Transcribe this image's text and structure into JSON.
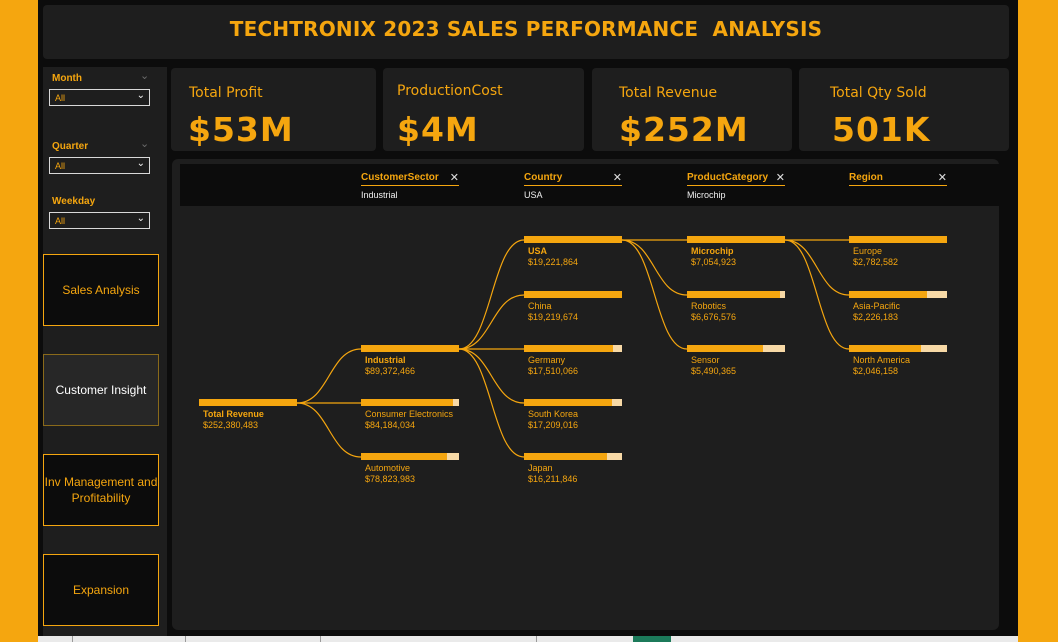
{
  "title": "TECHTRONIX 2023 SALES PERFORMANCE  ANALYSIS",
  "slicers": [
    {
      "label": "Month",
      "value": "All"
    },
    {
      "label": "Quarter",
      "value": "All"
    },
    {
      "label": "Weekday",
      "value": "All"
    }
  ],
  "nav": [
    {
      "label": "Sales Analysis"
    },
    {
      "label": "Customer Insight"
    },
    {
      "label": "Inv Management and Profitability"
    },
    {
      "label": "Expansion"
    }
  ],
  "kpis": [
    {
      "label": "Total Profit",
      "value": "$53M"
    },
    {
      "label": "ProductionCost",
      "value": "$4M"
    },
    {
      "label": "Total Revenue",
      "value": "$252M"
    },
    {
      "label": "Total Qty Sold",
      "value": "501K"
    }
  ],
  "tree": {
    "levels": [
      {
        "header": "CustomerSector",
        "selection": "Industrial"
      },
      {
        "header": "Country",
        "selection": "USA"
      },
      {
        "header": "ProductCategory",
        "selection": "Microchip"
      },
      {
        "header": "Region",
        "selection": ""
      }
    ],
    "root": {
      "label": "Total Revenue",
      "value": "$252,380,483",
      "fraction": 1.0
    },
    "columns": [
      [
        {
          "label": "Industrial",
          "value": "$89,372,466",
          "fraction": 1.0,
          "selected": true
        },
        {
          "label": "Consumer Electronics",
          "value": "$84,184,034",
          "fraction": 0.942
        },
        {
          "label": "Automotive",
          "value": "$78,823,983",
          "fraction": 0.882
        }
      ],
      [
        {
          "label": "USA",
          "value": "$19,221,864",
          "fraction": 1.0,
          "selected": true
        },
        {
          "label": "China",
          "value": "$19,219,674",
          "fraction": 1.0
        },
        {
          "label": "Germany",
          "value": "$17,510,066",
          "fraction": 0.911
        },
        {
          "label": "South Korea",
          "value": "$17,209,016",
          "fraction": 0.895
        },
        {
          "label": "Japan",
          "value": "$16,211,846",
          "fraction": 0.843
        }
      ],
      [
        {
          "label": "Microchip",
          "value": "$7,054,923",
          "fraction": 1.0,
          "selected": true
        },
        {
          "label": "Robotics",
          "value": "$6,676,576",
          "fraction": 0.946
        },
        {
          "label": "Sensor",
          "value": "$5,490,365",
          "fraction": 0.778
        }
      ],
      [
        {
          "label": "Europe",
          "value": "$2,782,582",
          "fraction": 1.0
        },
        {
          "label": "Asia-Pacific",
          "value": "$2,226,183",
          "fraction": 0.8
        },
        {
          "label": "North America",
          "value": "$2,046,158",
          "fraction": 0.735
        }
      ]
    ]
  },
  "colors": {
    "accent": "#f5a60f",
    "background": "#0c0c0c",
    "panel": "#1e1e1e",
    "bar_track": "#f7d9a6"
  },
  "icons": {
    "slicer_expand": "chevron-down-icon",
    "dropdown": "chevron-down-icon",
    "remove_level": "close-icon"
  }
}
